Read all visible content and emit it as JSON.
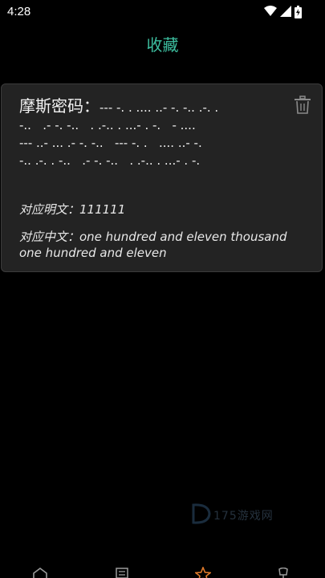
{
  "status_bar": {
    "time": "4:28",
    "icons": [
      "wifi-icon",
      "signal-icon",
      "battery-icon"
    ]
  },
  "header": {
    "title": "收藏"
  },
  "favorite_card": {
    "morse_label": "摩斯密码：",
    "morse_lines": [
      "--- -. .   .... ..- -. -.. .-. .",
      "-..   .- -. -..   . .-.. . ...- . -.   - ....",
      "--- ..- ... .- -. -..   --- -. .   .... ..- -.",
      "-.. .-. . -..   .- -. -..   . .-.. . ...- . -."
    ],
    "plain_text_line": "对应明文：111111",
    "chinese_line": "对应中文：one hundred and eleven thousand one hundred and eleven",
    "delete_icon": "trash-icon"
  },
  "watermark": {
    "text": "175游戏网"
  },
  "bottom_nav": {
    "items": [
      "home-icon",
      "list-icon",
      "star-icon",
      "settings-icon"
    ],
    "active_color": "#e07a2a",
    "inactive_color": "#9a9a9a"
  },
  "colors": {
    "accent": "#3dbfa0",
    "card_bg": "#232323",
    "background": "#000000"
  }
}
